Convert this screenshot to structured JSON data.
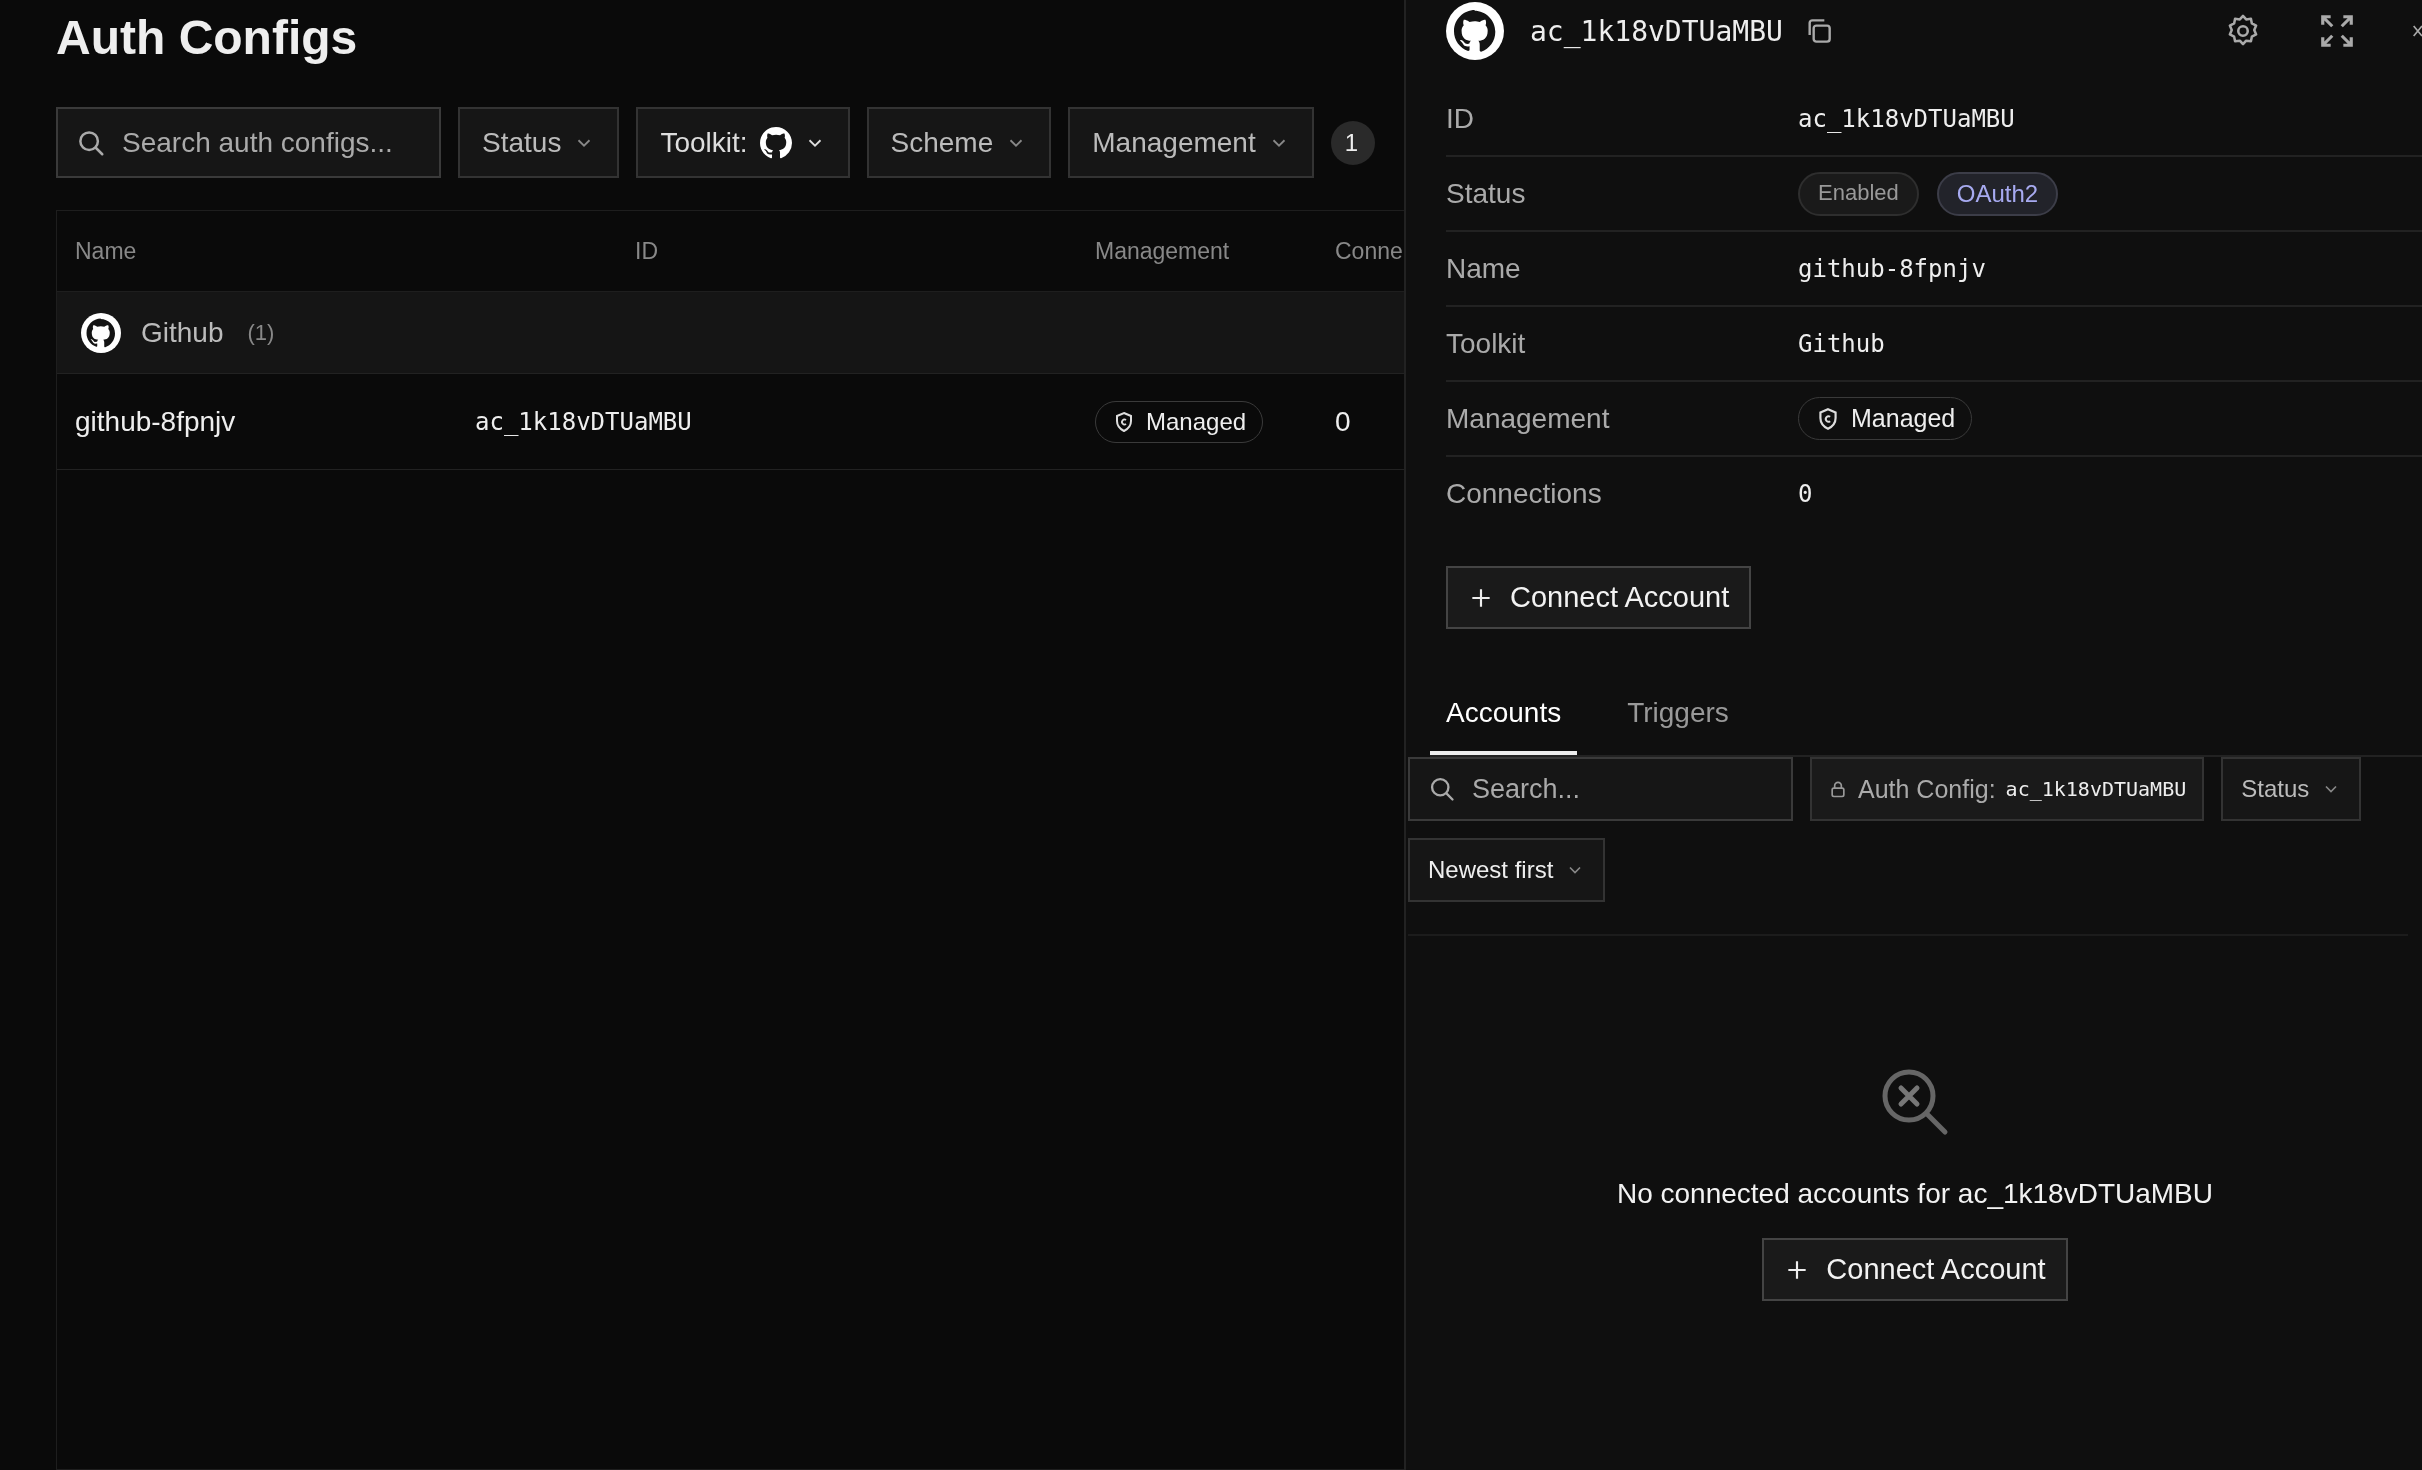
{
  "page": {
    "title": "Auth Configs"
  },
  "filters": {
    "search": {
      "placeholder": "Search auth configs..."
    },
    "dropdowns": [
      {
        "label": "Status",
        "kind": "text"
      },
      {
        "label": "Toolkit:",
        "kind": "toolkit"
      },
      {
        "label": "Scheme",
        "kind": "text"
      },
      {
        "label": "Management",
        "kind": "text"
      }
    ],
    "count_badge": "1"
  },
  "table": {
    "columns": [
      "Name",
      "ID",
      "Management",
      "Conne"
    ],
    "groups": [
      {
        "name": "Github",
        "count": "(1)",
        "rows": [
          {
            "name": "github-8fpnjv",
            "id": "ac_1k18vDTUaMBU",
            "management": "Managed",
            "connections": "0"
          }
        ]
      }
    ]
  },
  "detail_panel": {
    "title": "ac_1k18vDTUaMBU",
    "fields": [
      {
        "label": "ID",
        "kind": "mono",
        "value": "ac_1k18vDTUaMBU"
      },
      {
        "label": "Status",
        "kind": "badges",
        "badges": [
          {
            "text": "Enabled",
            "kind": "neutral"
          },
          {
            "text": "OAuth2",
            "kind": "scheme"
          }
        ]
      },
      {
        "label": "Name",
        "kind": "mono",
        "value": "github-8fpnjv"
      },
      {
        "label": "Toolkit",
        "kind": "mono",
        "value": "Github"
      },
      {
        "label": "Management",
        "kind": "managed",
        "value": "Managed"
      },
      {
        "label": "Connections",
        "kind": "mono",
        "value": "0"
      }
    ],
    "connect_button": "Connect Account",
    "tabs": [
      {
        "label": "Accounts",
        "selected": true
      },
      {
        "label": "Triggers",
        "selected": false
      }
    ],
    "accounts_filters": {
      "search": {
        "placeholder": "Search..."
      },
      "auth_config_chip": {
        "label": "Auth Config:",
        "value": "ac_1k18vDTUaMBU"
      },
      "dropdowns": [
        "Status",
        "Newest first"
      ]
    },
    "empty_state": {
      "message": "No connected accounts for ac_1k18vDTUaMBU",
      "button": "Connect Account"
    }
  }
}
